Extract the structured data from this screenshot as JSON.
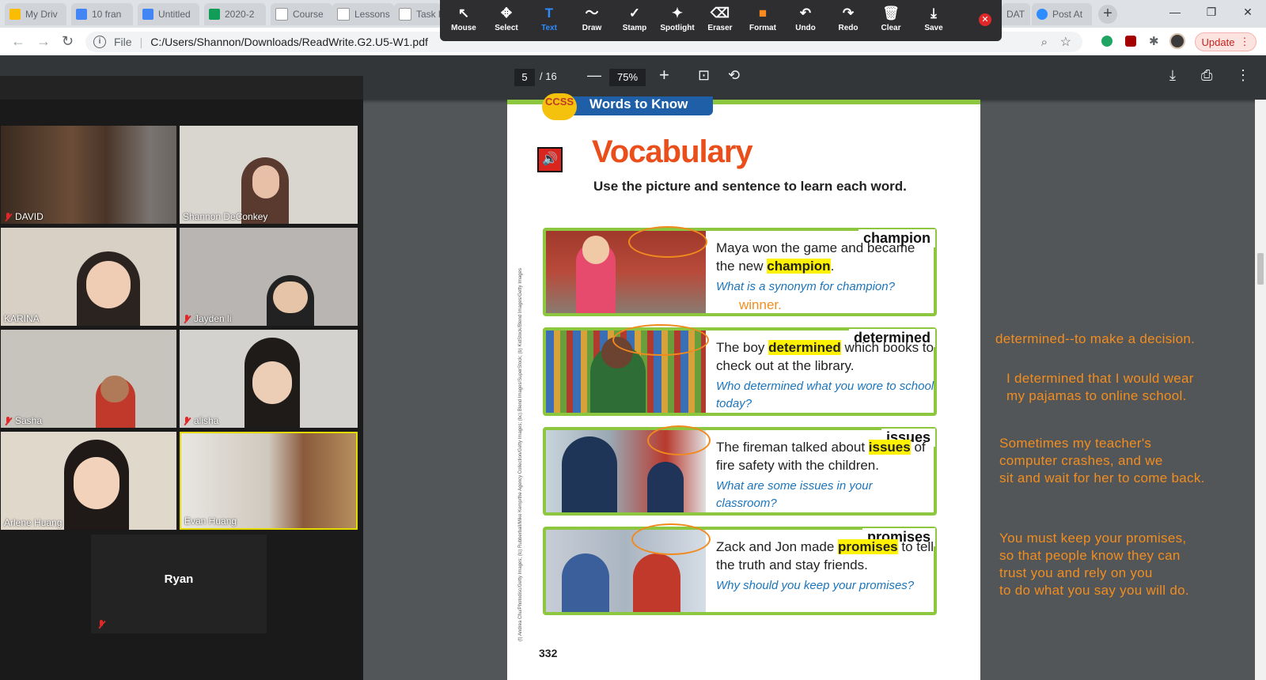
{
  "browser": {
    "tabs": [
      {
        "label": "My Driv",
        "color": "#fbbc04"
      },
      {
        "label": "10 fran",
        "color": "#4285f4"
      },
      {
        "label": "Untitled",
        "color": "#4285f4"
      },
      {
        "label": "2020-2",
        "color": "#0f9d58"
      },
      {
        "label": "Course",
        "color": "#e8e8e8"
      },
      {
        "label": "Lessons",
        "color": "#e8e8e8"
      },
      {
        "label": "Task l",
        "color": "#e8e8e8"
      },
      {
        "label": "DAT",
        "color": "#e8e8e8"
      },
      {
        "label": "Post At",
        "color": "#2d8cff"
      }
    ],
    "new_tab": "+",
    "file_label": "File",
    "url": "C:/Users/Shannon/Downloads/ReadWrite.G2.U5-W1.pdf",
    "update_label": "Update",
    "window_controls": {
      "minimize": "—",
      "maximize": "❐",
      "close": "✕"
    }
  },
  "annotate_toolbar": {
    "tools": [
      {
        "label": "Mouse",
        "icon": "↖"
      },
      {
        "label": "Select",
        "icon": "✥"
      },
      {
        "label": "Text",
        "icon": "T"
      },
      {
        "label": "Draw",
        "icon": "〜"
      },
      {
        "label": "Stamp",
        "icon": "✓"
      },
      {
        "label": "Spotlight",
        "icon": "✦"
      },
      {
        "label": "Eraser",
        "icon": "⌫"
      },
      {
        "label": "Format",
        "icon": "■"
      },
      {
        "label": "Undo",
        "icon": "↶"
      },
      {
        "label": "Redo",
        "icon": "↷"
      },
      {
        "label": "Clear",
        "icon": "🗑"
      },
      {
        "label": "Save",
        "icon": "⤓"
      }
    ],
    "close": "✕",
    "active_color": "#2d8cff",
    "format_color": "#ff8a1e"
  },
  "pdf_toolbar": {
    "page_current": "5",
    "page_total": "/ 16",
    "zoom_minus": "—",
    "zoom_level": "75%",
    "zoom_plus": "+"
  },
  "participants": [
    {
      "name": "DAVID",
      "muted": true,
      "bg": "#4a3428"
    },
    {
      "name": "Shannon DeConkey",
      "muted": false,
      "bg": "#d9d5cf"
    },
    {
      "name": "KARINA",
      "muted": false,
      "bg": "#d8cfc5"
    },
    {
      "name": "Jayden li",
      "muted": true,
      "bg": "#b9b5b2"
    },
    {
      "name": "Sasha",
      "muted": true,
      "bg": "#c7c3bd"
    },
    {
      "name": "alisha",
      "muted": true,
      "bg": "#d4d2cf"
    },
    {
      "name": "Arlene Huang",
      "muted": false,
      "bg": "#e1d8cc"
    },
    {
      "name": "Evan Huang",
      "muted": false,
      "bg": "#c9b69a",
      "active_speaker": true
    }
  ],
  "audio_only": {
    "name": "Ryan",
    "muted": true
  },
  "pdf_page": {
    "banner": "Words to Know",
    "badge": "CCSS",
    "title": "Vocabulary",
    "subtitle": "Use the picture and sentence to learn each word.",
    "page_number": "332",
    "credits": "(t) Andrea Chu/Photodisc/Getty Images; (tc) Rubberball/Mike Kemp/the Agency Collection/Getty Images; (bc) Blend Images/SuperStock; (b) KidStock/Blend Images/Getty Images",
    "cards": [
      {
        "word": "champion",
        "sentence_pre": "Maya won the game and became the new ",
        "highlight": "champion",
        "sentence_post": ".",
        "question": "What is a synonym for champion?",
        "handwriting": "winner."
      },
      {
        "word": "determined",
        "sentence_pre": "The boy ",
        "highlight": "determined",
        "sentence_post": " which books to check out at the library.",
        "question": "Who determined what you wore to school today?",
        "handwriting": ""
      },
      {
        "word": "issues",
        "sentence_pre": "The fireman talked about ",
        "highlight": "issues",
        "sentence_post": " of fire safety with the children.",
        "question": "What are some issues in your classroom?",
        "handwriting": ""
      },
      {
        "word": "promises",
        "sentence_pre": "Zack and Jon made ",
        "highlight": "promises",
        "sentence_post": " to tell the truth and stay friends.",
        "question": "Why should you keep your promises?",
        "handwriting": ""
      }
    ]
  },
  "annotations": [
    "determined--to make a decision.",
    "I determined that I would wear\nmy pajamas to online school.",
    "Sometimes my teacher's\ncomputer crashes, and we\nsit and wait for her to come back.",
    "You must keep your promises,\nso that people know they can\ntrust you and rely on you\nto do what you say you will do."
  ],
  "colors": {
    "annotation": "#f28d1f",
    "card_border": "#8dc63f",
    "title": "#e94e1b",
    "question": "#1b75bc",
    "highlight": "#fff200"
  }
}
